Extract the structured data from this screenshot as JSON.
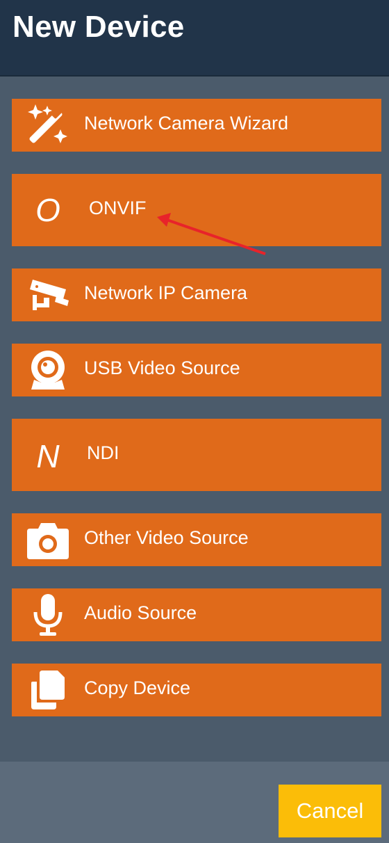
{
  "header": {
    "title": "New Device"
  },
  "menu": {
    "items": [
      {
        "label": "Network Camera Wizard",
        "icon": "magic-wand-icon"
      },
      {
        "label": "ONVIF",
        "icon": "letter-o-icon",
        "icon_glyph": "O"
      },
      {
        "label": "Network IP Camera",
        "icon": "security-camera-icon"
      },
      {
        "label": "USB Video Source",
        "icon": "webcam-icon"
      },
      {
        "label": "NDI",
        "icon": "letter-n-icon",
        "icon_glyph": "N"
      },
      {
        "label": "Other Video Source",
        "icon": "camera-icon"
      },
      {
        "label": "Audio Source",
        "icon": "microphone-icon"
      },
      {
        "label": "Copy Device",
        "icon": "copy-icon"
      }
    ]
  },
  "footer": {
    "cancel_label": "Cancel"
  },
  "colors": {
    "header_bg": "#213449",
    "body_bg": "#4b5b6b",
    "item_bg": "#e06a1a",
    "footer_bg": "#5c6b7b",
    "cancel_bg": "#fbbd08",
    "annotation_arrow": "#e8232a"
  }
}
